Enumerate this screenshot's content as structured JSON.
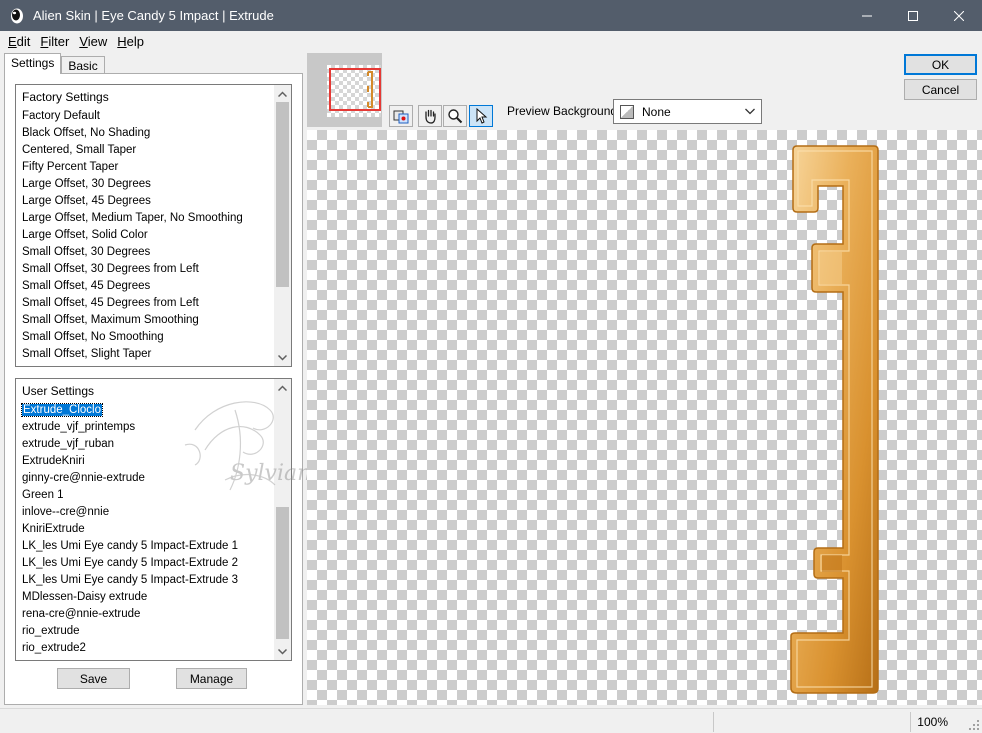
{
  "title": "Alien Skin | Eye Candy 5 Impact | Extrude",
  "menu": [
    {
      "label": "Edit",
      "u": "E",
      "rest": "dit"
    },
    {
      "label": "Filter",
      "u": "F",
      "rest": "ilter"
    },
    {
      "label": "View",
      "u": "V",
      "rest": "iew"
    },
    {
      "label": "Help",
      "u": "H",
      "rest": "elp"
    }
  ],
  "tabs": {
    "settings": "Settings",
    "basic": "Basic"
  },
  "factory": {
    "header": "Factory Settings",
    "items": [
      "Factory Default",
      "Black Offset, No Shading",
      "Centered, Small Taper",
      "Fifty Percent Taper",
      "Large Offset, 30 Degrees",
      "Large Offset, 45 Degrees",
      "Large Offset, Medium Taper, No Smoothing",
      "Large Offset, Solid Color",
      "Small Offset, 30 Degrees",
      "Small Offset, 30 Degrees from Left",
      "Small Offset, 45 Degrees",
      "Small Offset, 45 Degrees from Left",
      "Small Offset, Maximum Smoothing",
      "Small Offset, No Smoothing",
      "Small Offset, Slight Taper"
    ]
  },
  "user": {
    "header": "User Settings",
    "items": [
      "Extrude_Cloclo",
      "extrude_vjf_printemps",
      "extrude_vjf_ruban",
      "ExtrudeKniri",
      "ginny-cre@nnie-extrude",
      "Green 1",
      "inlove--cre@nnie",
      "KniriExtrude",
      "LK_les Umi Eye candy 5 Impact-Extrude 1",
      "LK_les Umi Eye candy 5 Impact-Extrude 2",
      "LK_les Umi Eye candy 5 Impact-Extrude 3",
      "MDlessen-Daisy extrude",
      "rena-cre@nnie-extrude",
      "rio_extrude",
      "rio_extrude2"
    ],
    "selected_index": 0,
    "watermark": "Sylviane"
  },
  "buttons": {
    "save": "Save",
    "manage": "Manage",
    "ok": "OK",
    "cancel": "Cancel"
  },
  "preview_bg": {
    "label": "Preview Background:",
    "value": "None"
  },
  "status": {
    "zoom": "100%"
  },
  "colors": {
    "gold_light": "#f2c27a",
    "gold_dark": "#c97a1e",
    "titlebar": "#535d6b"
  }
}
